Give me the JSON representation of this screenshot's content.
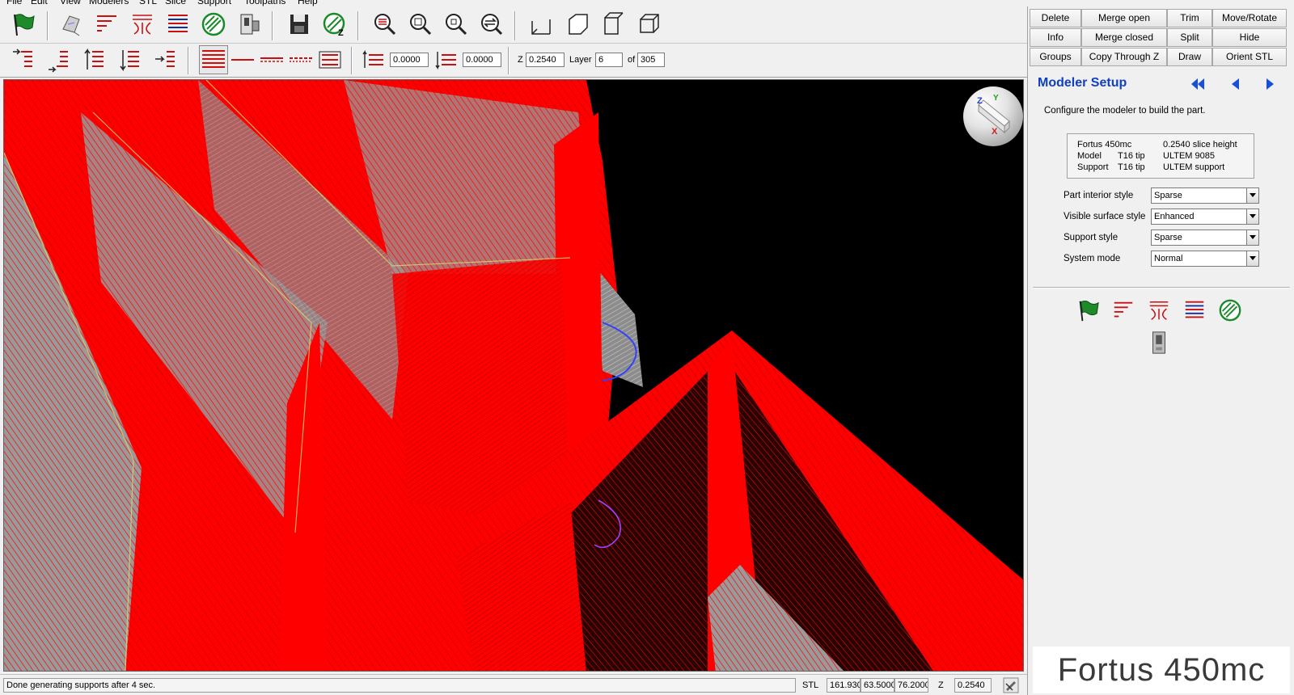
{
  "menu": [
    "File",
    "Edit",
    "View",
    "Modelers",
    "STL",
    "Slice",
    "Support",
    "Toolpaths",
    "Help"
  ],
  "toolbar1": {
    "icons": [
      "green-flag-icon",
      "import-icon",
      "slice-icon",
      "support-icon",
      "toolpath-icon",
      "sparse-fill-icon",
      "modeler-icon",
      "save-icon",
      "fill-z-icon",
      "zoom-in-icon",
      "zoom-fit-icon",
      "zoom-out-icon",
      "rotate-view-icon",
      "view-front-icon",
      "view-side-icon",
      "view-top-icon",
      "view-iso-icon"
    ]
  },
  "toolbar2": {
    "field1": "0.0000",
    "field2": "0.0000",
    "z_label": "Z",
    "z_value": "0.2540",
    "layer_label": "Layer",
    "layer_value": "6",
    "of_label": "of",
    "layer_total": "305"
  },
  "status": {
    "message": "Done generating supports after 4 sec.",
    "stl_label": "STL",
    "x_value": "161.930",
    "y_value": "63.5000",
    "z_value": "76.2000",
    "z_label": "Z",
    "z_field": "0.2540"
  },
  "commands": {
    "row1": [
      "Delete",
      "Merge open",
      "Trim",
      "Move/Rotate"
    ],
    "row2": [
      "Info",
      "Merge closed",
      "Split",
      "Hide"
    ],
    "row3": [
      "Groups",
      "Copy Through Z",
      "Draw",
      "Orient STL"
    ]
  },
  "panel": {
    "title": "Modeler Setup",
    "description": "Configure the modeler to build the part.",
    "info": {
      "modeler": "Fortus 450mc",
      "slice_height": "0.2540 slice height",
      "model_label": "Model",
      "model_tip": "T16 tip",
      "model_material": "ULTEM 9085",
      "support_label": "Support",
      "support_tip": "T16 tip",
      "support_material": "ULTEM support"
    },
    "fields": [
      {
        "label": "Part interior style",
        "value": "Sparse"
      },
      {
        "label": "Visible surface style",
        "value": "Enhanced"
      },
      {
        "label": "Support style",
        "value": "Sparse"
      },
      {
        "label": "System mode",
        "value": "Normal"
      }
    ],
    "brand": "Fortus 450mc"
  },
  "colors": {
    "toolpath_red": "#ff0000",
    "title_blue": "#1040c0",
    "viewport_bg": "#000000"
  }
}
